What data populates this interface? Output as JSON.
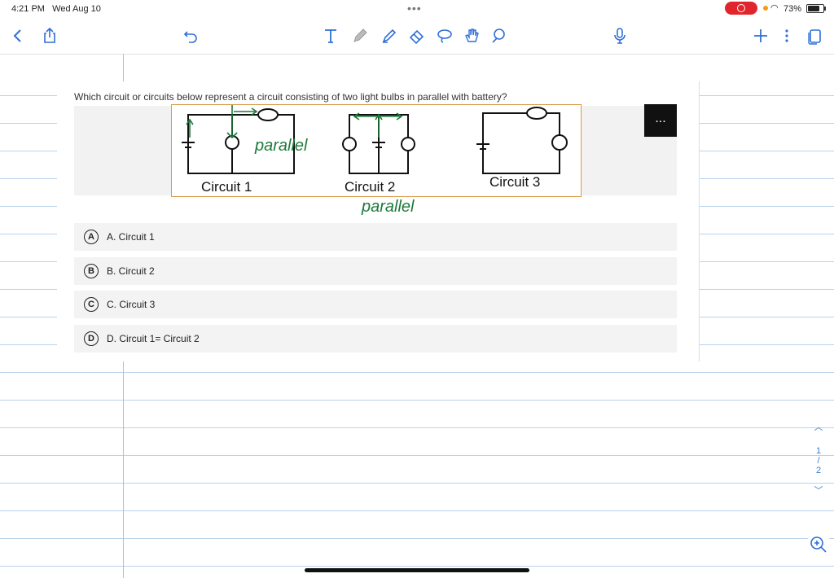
{
  "status_bar": {
    "time": "4:21 PM",
    "date": "Wed Aug 10",
    "battery": "73%"
  },
  "toolbar": {
    "icons": [
      "back-icon",
      "share-icon",
      "undo-icon",
      "text-tool-icon",
      "pencil-icon",
      "highlighter-icon",
      "eraser-icon",
      "lasso-icon",
      "hand-icon",
      "shape-icon",
      "microphone-icon",
      "add-icon",
      "more-icon",
      "pages-icon"
    ]
  },
  "question": {
    "text": "Which circuit or circuits below represent a circuit consisting of two light bulbs in parallel with battery?",
    "circuit_labels": [
      "Circuit 1",
      "Circuit 2",
      "Circuit 3"
    ],
    "more_label": "..."
  },
  "annotations": {
    "note1": "parallel",
    "note2": "parallel"
  },
  "options": [
    {
      "letter": "A",
      "text": "A. Circuit 1"
    },
    {
      "letter": "B",
      "text": "B. Circuit 2"
    },
    {
      "letter": "C",
      "text": "C. Circuit 3"
    },
    {
      "letter": "D",
      "text": "D. Circuit 1= Circuit 2"
    }
  ],
  "page_nav": {
    "current": "1",
    "separator": "/",
    "total": "2"
  },
  "colors": {
    "ink": "#1d7a3a",
    "margin": "#f2a6b0",
    "rule": "#b9d3ec",
    "record": "#e0262c"
  }
}
